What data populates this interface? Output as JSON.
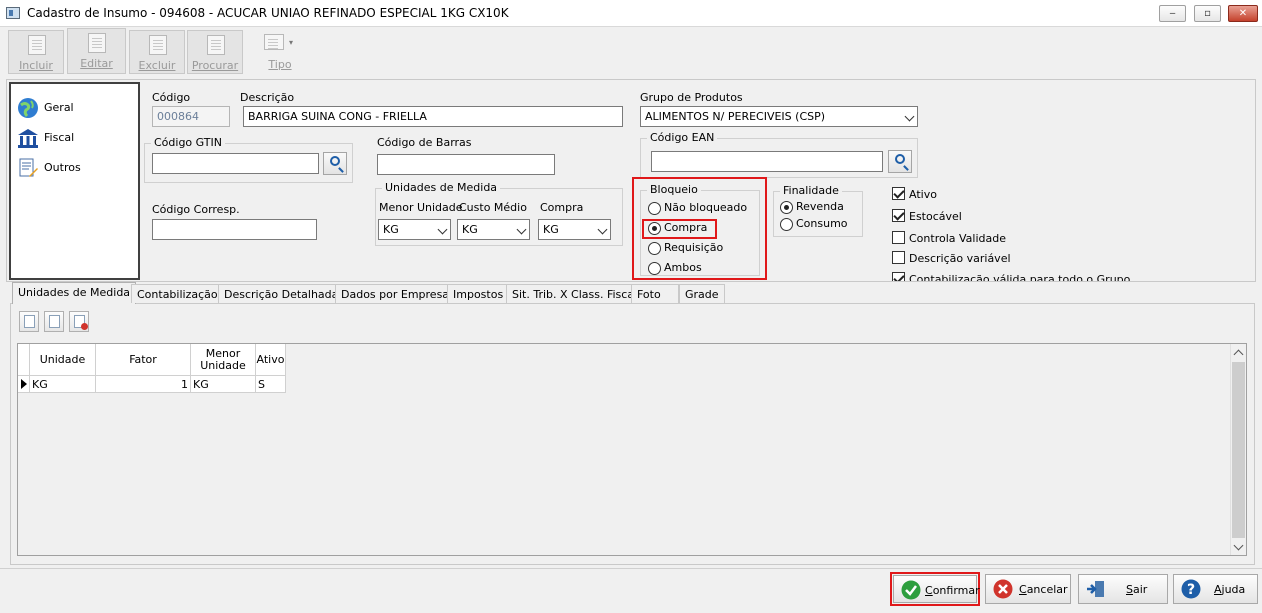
{
  "window": {
    "title": "Cadastro de Insumo - 094608 - ACUCAR UNIAO REFINADO ESPECIAL 1KG CX10K"
  },
  "toolbar": {
    "incluir": "Incluir",
    "editar": "Editar",
    "excluir": "Excluir",
    "procurar": "Procurar",
    "tipo": "Tipo"
  },
  "sidebar": {
    "items": [
      {
        "label": "Geral",
        "icon": "globe-icon"
      },
      {
        "label": "Fiscal",
        "icon": "bank-icon"
      },
      {
        "label": "Outros",
        "icon": "document-edit-icon"
      }
    ]
  },
  "form": {
    "codigo_label": "Código",
    "codigo_value": "000864",
    "descricao_label": "Descrição",
    "descricao_value": "BARRIGA SUINA CONG - FRIELLA",
    "grupo_label": "Grupo de Produtos",
    "grupo_value": "ALIMENTOS N/ PERECIVEIS  (CSP)",
    "gtin_label": "Código GTIN",
    "gtin_value": "",
    "barras_label": "Código de Barras",
    "barras_value": "",
    "ean_label": "Código EAN",
    "ean_value": "",
    "corresp_label": "Código Corresp.",
    "corresp_value": "",
    "unidades_title": "Unidades de Medida",
    "menor_unidade_label": "Menor Unidade",
    "menor_unidade_value": "KG",
    "custo_medio_label": "Custo Médio",
    "custo_medio_value": "KG",
    "compra_label": "Compra",
    "compra_value": "KG",
    "bloqueio_title": "Bloqueio",
    "bloqueio_options": [
      "Não bloqueado",
      "Compra",
      "Requisição",
      "Ambos"
    ],
    "bloqueio_selected": "Compra",
    "finalidade_title": "Finalidade",
    "finalidade_options": [
      "Revenda",
      "Consumo"
    ],
    "finalidade_selected": "Revenda",
    "checks": [
      {
        "label": "Ativo",
        "checked": true
      },
      {
        "label": "Estocável",
        "checked": true
      },
      {
        "label": "Controla Validade",
        "checked": false
      },
      {
        "label": "Descrição variável",
        "checked": false
      },
      {
        "label": "Contabilização válida para todo o Grupo",
        "checked": true
      }
    ]
  },
  "tabs": [
    "Unidades de Medida",
    "Contabilização",
    "Descrição Detalhada",
    "Dados por Empresa",
    "Impostos",
    "Sit. Trib. X Class. Fiscal",
    "Foto",
    "Grade"
  ],
  "grid": {
    "headers": [
      "Unidade",
      "Fator",
      "Menor Unidade",
      "Ativo"
    ],
    "rows": [
      {
        "unidade": "KG",
        "fator": "1",
        "menor": "KG",
        "ativo": "S"
      }
    ]
  },
  "footer": {
    "confirmar": "Confirmar",
    "cancelar": "Cancelar",
    "sair": "Sair",
    "ajuda": "Ajuda"
  },
  "colors": {
    "highlight": "#e0181a",
    "confirm": "#2e9e3e",
    "cancel": "#d0342c",
    "help": "#1e5ea8"
  }
}
